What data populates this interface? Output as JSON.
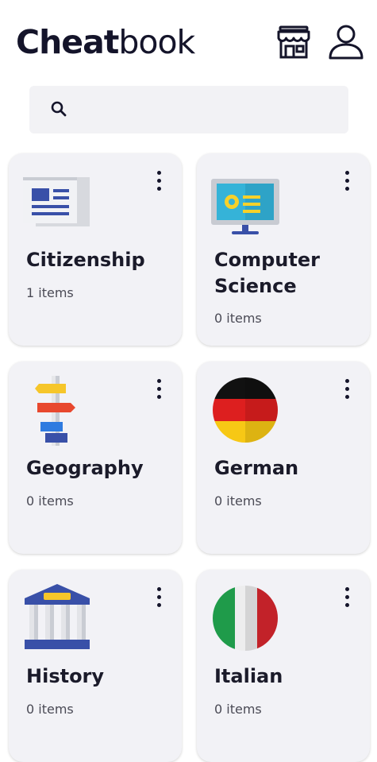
{
  "header": {
    "logo_bold": "Cheat",
    "logo_light": "book",
    "store_icon": "store-icon",
    "profile_icon": "profile-icon"
  },
  "search": {
    "placeholder": "",
    "value": "",
    "icon": "search-icon"
  },
  "categories": [
    {
      "name": "Citizenship",
      "count": "1 items",
      "icon": "newspaper-icon"
    },
    {
      "name": "Computer Science",
      "count": "0 items",
      "icon": "monitor-icon"
    },
    {
      "name": "Geography",
      "count": "0 items",
      "icon": "signpost-icon"
    },
    {
      "name": "German",
      "count": "0 items",
      "icon": "germany-flag-icon"
    },
    {
      "name": "History",
      "count": "0 items",
      "icon": "museum-icon"
    },
    {
      "name": "Italian",
      "count": "0 items",
      "icon": "italy-flag-icon"
    }
  ]
}
